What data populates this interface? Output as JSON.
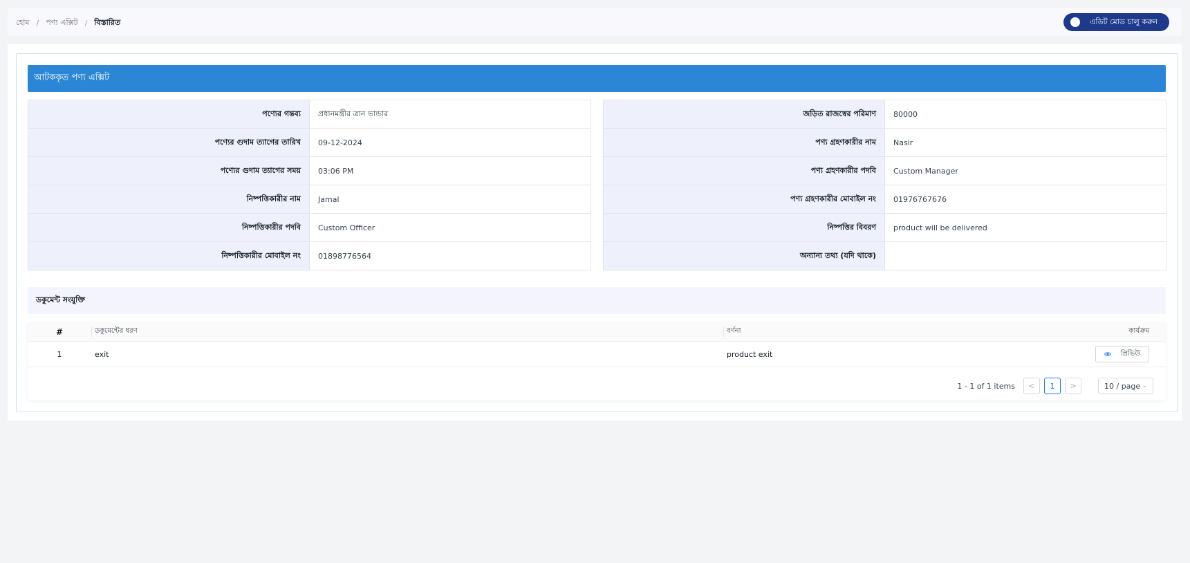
{
  "breadcrumb": {
    "home": "হোম",
    "section": "পণ্য এক্সিট",
    "current": "বিস্তারিত"
  },
  "edit_toggle": {
    "label": "এডিট মোড চালু করুন"
  },
  "section_title": "আটককৃত পণ্য এক্সিট",
  "left_info": [
    {
      "label": "পণ্যের গন্তব্য",
      "value": "প্রধানমন্ত্রীর ত্রান ভান্ডার"
    },
    {
      "label": "পণ্যের গুদাম ত্যাগের তারিখ",
      "value": "09-12-2024"
    },
    {
      "label": "পণ্যের গুদাম ত্যাগের সময়",
      "value": "03:06 PM"
    },
    {
      "label": "নিষ্পত্তিকারীর নাম",
      "value": "Jamal"
    },
    {
      "label": "নিষ্পত্তিকারীর পদবি",
      "value": "Custom Officer"
    },
    {
      "label": "নিষ্পত্তিকারীর মোবাইল নং",
      "value": "01898776564"
    }
  ],
  "right_info": [
    {
      "label": "জড়িত রাজস্বের পরিমাণ",
      "value": "80000"
    },
    {
      "label": "পণ্য গ্রহণকারীর নাম",
      "value": "Nasir"
    },
    {
      "label": "পণ্য গ্রহণকারীর পদবি",
      "value": "Custom Manager"
    },
    {
      "label": "পণ্য গ্রহণকারীর মোবাইল নং",
      "value": "01976767676"
    },
    {
      "label": "নিষ্পত্তির বিবরণ",
      "value": "product will be delivered"
    },
    {
      "label": "অন্যান্য তথ্য (যদি থাকে)",
      "value": ""
    }
  ],
  "documents": {
    "title": "ডকুমেন্ট সংযুক্তি",
    "columns": {
      "num": "#",
      "type": "ডকুমেন্টের ধরণ",
      "desc": "বর্ণনা",
      "action": "কার্যক্রম"
    },
    "rows": [
      {
        "num": "1",
        "type": "exit",
        "desc": "product exit",
        "action": "প্রিভিউ"
      }
    ],
    "pagination": {
      "total": "1 - 1 of 1 items",
      "prev": "<",
      "page": "1",
      "next": ">",
      "page_size": "10 / page"
    }
  },
  "colors": {
    "header_blue": "#2b87d6",
    "toggle_navy": "#1e3a8a",
    "label_bg": "#eef0fc"
  }
}
